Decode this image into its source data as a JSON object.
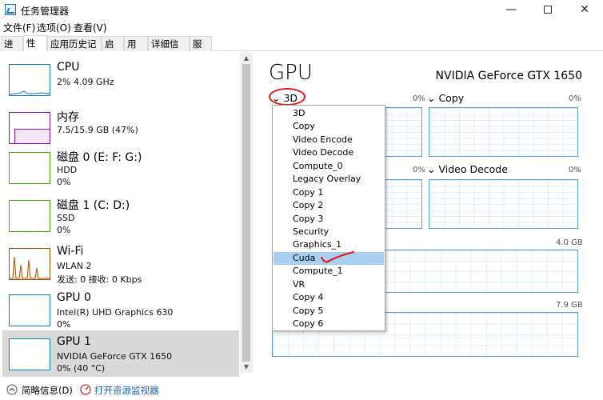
{
  "window": {
    "title": "任务管理器",
    "controls": {
      "minimize": "—",
      "close": "✕"
    }
  },
  "menu": [
    "文件(F)",
    "选项(O)",
    "查看(V)"
  ],
  "tabs": [
    "进程",
    "性能",
    "应用历史记录",
    "启动",
    "用户",
    "详细信息",
    "服务"
  ],
  "active_tab": "性能",
  "resources": [
    {
      "title": "CPU",
      "line1": "2% 4.09 GHz",
      "line2": "",
      "color": "#117dbb"
    },
    {
      "title": "内存",
      "line1": "7.5/15.9 GB (47%)",
      "line2": "",
      "color": "#8b12ae"
    },
    {
      "title": "磁盘 0 (E: F: G:)",
      "line1": "HDD",
      "line2": "0%",
      "color": "#4da60c"
    },
    {
      "title": "磁盘 1 (C: D:)",
      "line1": "SSD",
      "line2": "0%",
      "color": "#4da60c"
    },
    {
      "title": "Wi-Fi",
      "line1": "WLAN 2",
      "line2": "发送: 0 接收: 0 Kbps",
      "color": "#a74f01"
    },
    {
      "title": "GPU 0",
      "line1": "Intel(R) UHD Graphics 630",
      "line2": "0%",
      "color": "#117dbb"
    },
    {
      "title": "GPU 1",
      "line1": "NVIDIA GeForce GTX 1650",
      "line2": "0% (40 °C)",
      "color": "#117dbb"
    }
  ],
  "selected_resource_index": 6,
  "main": {
    "heading": "GPU",
    "model": "NVIDIA GeForce GTX 1650",
    "engines": [
      {
        "label": "3D",
        "pct": "0%"
      },
      {
        "label": "Copy",
        "pct": "0%"
      },
      {
        "label": "",
        "pct": "0%"
      },
      {
        "label": "Video Decode",
        "pct": "0%"
      }
    ],
    "dedicated_mem_max": "4.0 GB",
    "shared_mem_max": "7.9 GB"
  },
  "dropdown": {
    "items": [
      "3D",
      "Copy",
      "Video Encode",
      "Video Decode",
      "Compute_0",
      "Legacy Overlay",
      "Copy 1",
      "Copy 2",
      "Copy 3",
      "Security",
      "Graphics_1",
      "Cuda",
      "Compute_1",
      "VR",
      "Copy 4",
      "Copy 5",
      "Copy 6"
    ],
    "highlighted": "Cuda"
  },
  "status": {
    "brief_info": "简略信息(D)",
    "open_monitor": "打开资源监视器"
  },
  "colors": {
    "annotation_red": "#e01818",
    "selection": "#d9d9d9",
    "dropdown_highlight": "#a9cff0",
    "graph_border": "#5a9bd4",
    "link": "#1a5fb4"
  }
}
